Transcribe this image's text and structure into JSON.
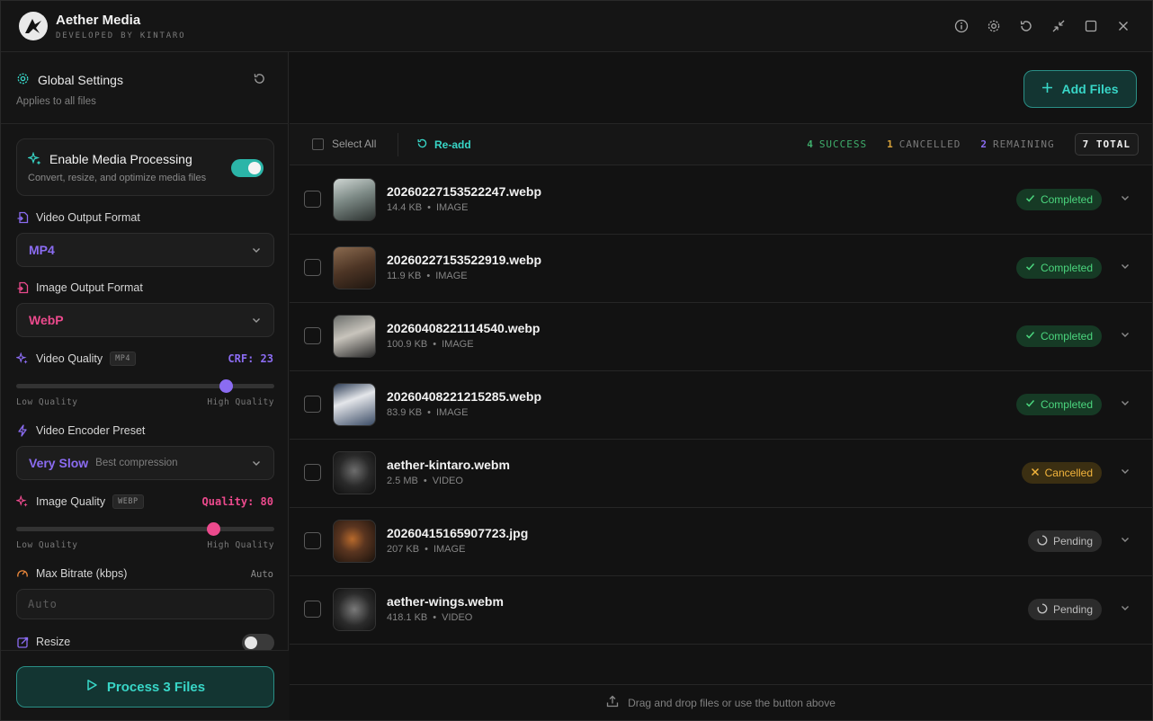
{
  "app": {
    "title": "Aether Media",
    "subtitle": "DEVELOPED BY KINTARO"
  },
  "window_buttons": [
    "info-icon",
    "gear-icon",
    "refresh-icon",
    "collapse-icon",
    "maximize-icon",
    "close-icon"
  ],
  "sidebar": {
    "heading": "Global Settings",
    "subheading": "Applies to all files",
    "media_processing": {
      "title": "Enable Media Processing",
      "description": "Convert, resize, and optimize media files",
      "enabled": true
    },
    "video_output_format": {
      "label": "Video Output Format",
      "value": "MP4",
      "color": "#8b6cf2"
    },
    "image_output_format": {
      "label": "Image Output Format",
      "value": "WebP",
      "color": "#ec4a8d"
    },
    "video_quality": {
      "label": "Video Quality",
      "tag": "MP4",
      "value_text": "CRF: 23",
      "fraction": 0.83,
      "low": "Low Quality",
      "high": "High Quality",
      "color": "#8b6cf2"
    },
    "encoder_preset": {
      "label": "Video Encoder Preset",
      "value": "Very Slow",
      "hint": "Best compression",
      "color": "#8b6cf2"
    },
    "image_quality": {
      "label": "Image Quality",
      "tag": "WEBP",
      "value_text": "Quality: 80",
      "fraction": 0.78,
      "low": "Low Quality",
      "high": "High Quality",
      "color": "#ec4a8d"
    },
    "max_bitrate": {
      "label": "Max Bitrate (kbps)",
      "right": "Auto",
      "placeholder": "Auto"
    },
    "resize": {
      "label": "Resize",
      "enabled": false
    },
    "process_button": "Process 3 Files"
  },
  "main": {
    "add_button": "Add Files",
    "toolbar": {
      "select_all": "Select All",
      "readd": "Re-add",
      "stats": [
        {
          "num": "4",
          "label": "SUCCESS",
          "color": "#3fae6c"
        },
        {
          "num": "1",
          "label": "CANCELLED",
          "color": "#d9a33a"
        },
        {
          "num": "2",
          "label": "REMAINING",
          "color": "#8b6cf2"
        }
      ],
      "total": "7 TOTAL"
    },
    "files": [
      {
        "name": "20260227153522247.webp",
        "size": "14.4 KB",
        "type": "IMAGE",
        "status": "Completed",
        "kind": "done"
      },
      {
        "name": "20260227153522919.webp",
        "size": "11.9 KB",
        "type": "IMAGE",
        "status": "Completed",
        "kind": "done"
      },
      {
        "name": "20260408221114540.webp",
        "size": "100.9 KB",
        "type": "IMAGE",
        "status": "Completed",
        "kind": "done"
      },
      {
        "name": "20260408221215285.webp",
        "size": "83.9 KB",
        "type": "IMAGE",
        "status": "Completed",
        "kind": "done"
      },
      {
        "name": "aether-kintaro.webm",
        "size": "2.5 MB",
        "type": "VIDEO",
        "status": "Cancelled",
        "kind": "cancel"
      },
      {
        "name": "20260415165907723.jpg",
        "size": "207 KB",
        "type": "IMAGE",
        "status": "Pending",
        "kind": "pend"
      },
      {
        "name": "aether-wings.webm",
        "size": "418.1 KB",
        "type": "VIDEO",
        "status": "Pending",
        "kind": "pend"
      }
    ],
    "dropzone": "Drag and drop files or use the button above"
  },
  "colors": {
    "accent": "#38d6c7",
    "violet": "#8b6cf2",
    "pink": "#ec4a8d"
  }
}
